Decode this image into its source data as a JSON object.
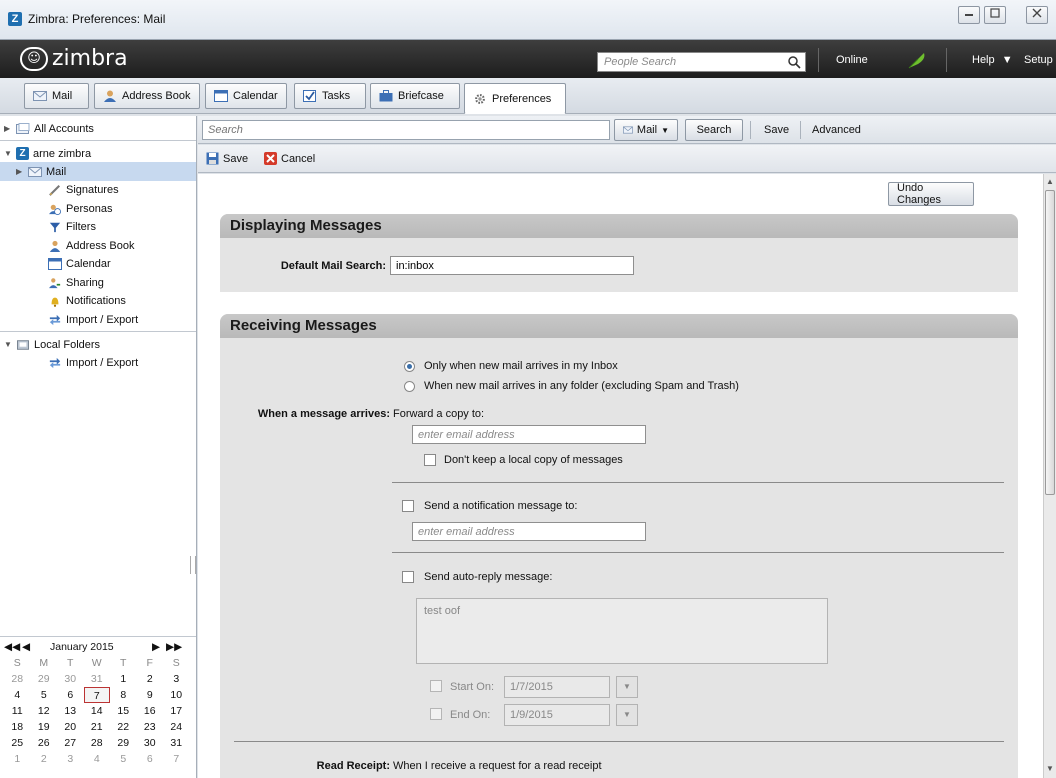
{
  "window": {
    "title": "Zimbra: Preferences: Mail"
  },
  "header": {
    "brand": "zimbra",
    "people_search_placeholder": "People Search",
    "online": "Online",
    "help": "Help",
    "setup": "Setup"
  },
  "app_tabs": [
    {
      "label": "Mail"
    },
    {
      "label": "Address Book"
    },
    {
      "label": "Calendar"
    },
    {
      "label": "Tasks"
    },
    {
      "label": "Briefcase"
    },
    {
      "label": "Preferences"
    }
  ],
  "tree": {
    "all_accounts": "All Accounts",
    "account": "arne zimbra",
    "items": [
      {
        "label": "Mail"
      },
      {
        "label": "Signatures"
      },
      {
        "label": "Personas"
      },
      {
        "label": "Filters"
      },
      {
        "label": "Address Book"
      },
      {
        "label": "Calendar"
      },
      {
        "label": "Sharing"
      },
      {
        "label": "Notifications"
      },
      {
        "label": "Import / Export"
      }
    ],
    "local_folders": "Local Folders",
    "local_items": [
      {
        "label": "Import / Export"
      }
    ]
  },
  "mini_calendar": {
    "month": "January 2015",
    "dow": [
      "S",
      "M",
      "T",
      "W",
      "T",
      "F",
      "S"
    ],
    "weeks": [
      [
        "28",
        "29",
        "30",
        "31",
        "1",
        "2",
        "3"
      ],
      [
        "4",
        "5",
        "6",
        "7",
        "8",
        "9",
        "10"
      ],
      [
        "11",
        "12",
        "13",
        "14",
        "15",
        "16",
        "17"
      ],
      [
        "18",
        "19",
        "20",
        "21",
        "22",
        "23",
        "24"
      ],
      [
        "25",
        "26",
        "27",
        "28",
        "29",
        "30",
        "31"
      ],
      [
        "1",
        "2",
        "3",
        "4",
        "5",
        "6",
        "7"
      ]
    ],
    "today": "7"
  },
  "search_bar": {
    "placeholder": "Search",
    "scope": "Mail",
    "search_button": "Search",
    "save": "Save",
    "advanced": "Advanced"
  },
  "action_bar": {
    "save": "Save",
    "cancel": "Cancel"
  },
  "undo_changes": "Undo Changes",
  "displaying": {
    "title": "Displaying Messages",
    "default_search_label": "Default Mail Search:",
    "default_search_value": "in:inbox"
  },
  "receiving": {
    "title": "Receiving Messages",
    "radio_1": "Only when new mail arrives in my Inbox",
    "radio_2": "When new mail arrives in any folder (excluding Spam and Trash)",
    "when_arrives_label": "When a message arrives:",
    "forward_copy": "Forward a copy to:",
    "email_placeholder": "enter email address",
    "dont_keep": "Don't keep a local copy of messages",
    "send_notification": "Send a notification message to:",
    "notification_placeholder": "enter email address",
    "send_autoreply": "Send auto-reply message:",
    "autoreply_text": "test oof",
    "start_on": "Start On:",
    "start_date": "1/7/2015",
    "end_on": "End On:",
    "end_date": "1/9/2015",
    "read_receipt_label": "Read Receipt:",
    "read_receipt_text": "When I receive a request for a read receipt"
  }
}
